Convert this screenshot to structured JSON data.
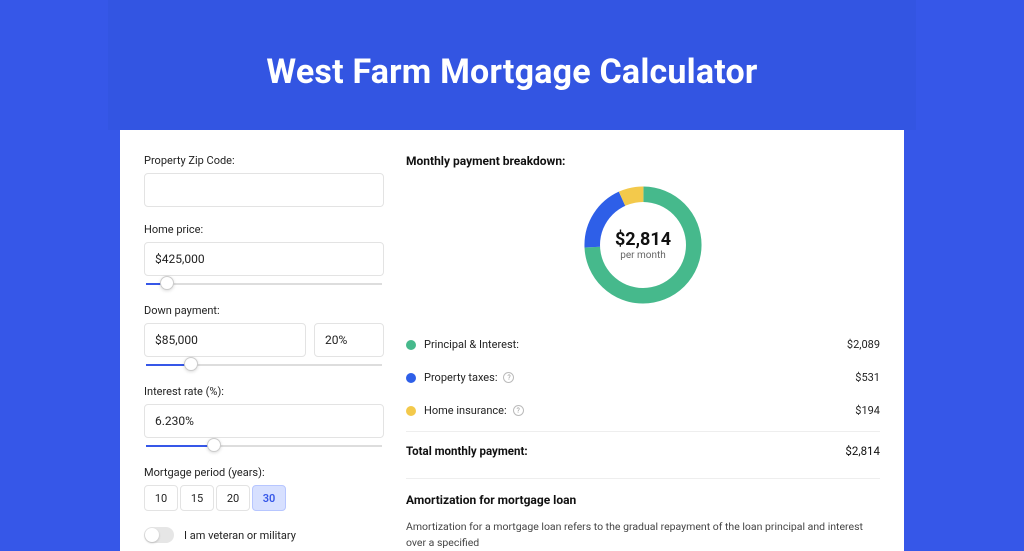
{
  "header": {
    "title": "West Farm Mortgage Calculator"
  },
  "form": {
    "zip_label": "Property Zip Code:",
    "zip_value": "",
    "home_price_label": "Home price:",
    "home_price_value": "$425,000",
    "home_price_slider_pct": 9,
    "down_payment_label": "Down payment:",
    "down_payment_value": "$85,000",
    "down_payment_pct": "20%",
    "down_payment_slider_pct": 19,
    "interest_label": "Interest rate (%):",
    "interest_value": "6.230%",
    "interest_slider_pct": 29,
    "period_label": "Mortgage period (years):",
    "periods": [
      "10",
      "15",
      "20",
      "30"
    ],
    "period_selected": "30",
    "veteran_label": "I am veteran or military"
  },
  "breakdown": {
    "title": "Monthly payment breakdown:",
    "total_amount": "$2,814",
    "total_sub": "per month",
    "rows": [
      {
        "color": "green",
        "label": "Principal & Interest:",
        "value": "$2,089",
        "info": false
      },
      {
        "color": "blue",
        "label": "Property taxes:",
        "value": "$531",
        "info": true
      },
      {
        "color": "yellow",
        "label": "Home insurance:",
        "value": "$194",
        "info": true
      }
    ],
    "total_label": "Total monthly payment:",
    "total_value": "$2,814"
  },
  "chart_data": {
    "type": "pie",
    "title": "Monthly payment breakdown",
    "series": [
      {
        "name": "Principal & Interest",
        "value": 2089,
        "color": "#46b98c"
      },
      {
        "name": "Property taxes",
        "value": 531,
        "color": "#2e5fe8"
      },
      {
        "name": "Home insurance",
        "value": 194,
        "color": "#f3c94b"
      }
    ],
    "center_label": "$2,814",
    "center_sub": "per month"
  },
  "amort": {
    "title": "Amortization for mortgage loan",
    "text": "Amortization for a mortgage loan refers to the gradual repayment of the loan principal and interest over a specified"
  }
}
